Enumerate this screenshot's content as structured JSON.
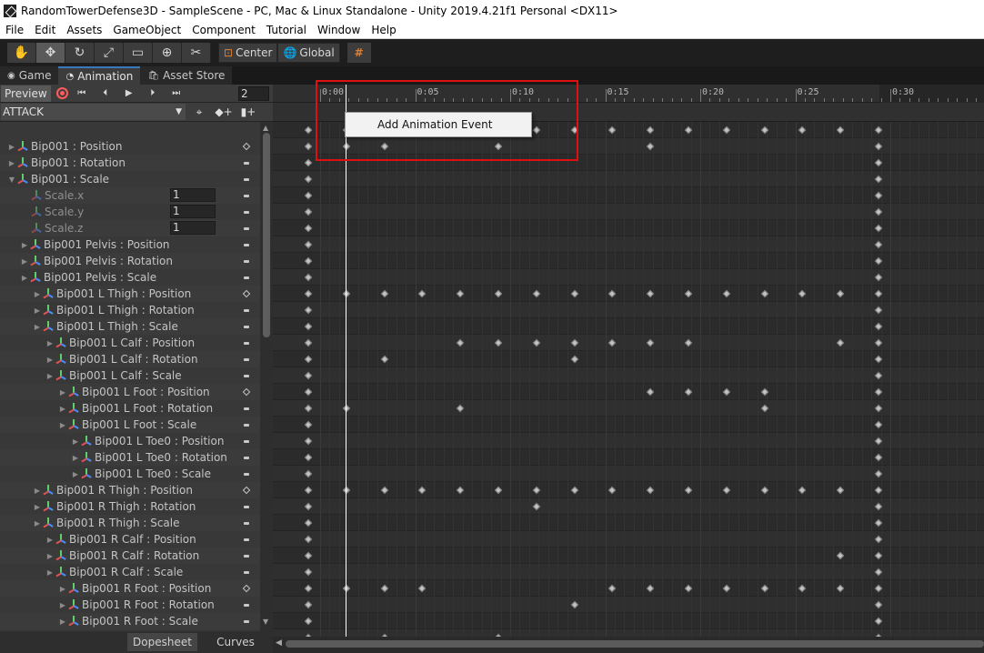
{
  "window": {
    "title": "RandomTowerDefense3D - SampleScene - PC, Mac & Linux Standalone - Unity 2019.4.21f1 Personal <DX11>"
  },
  "menu": [
    "File",
    "Edit",
    "Assets",
    "GameObject",
    "Component",
    "Tutorial",
    "Window",
    "Help"
  ],
  "toolbar": {
    "tools": [
      {
        "icon": "hand-icon",
        "glyph": "✋"
      },
      {
        "icon": "move-icon",
        "glyph": "✥"
      },
      {
        "icon": "rotate-icon",
        "glyph": "↻"
      },
      {
        "icon": "scale-icon",
        "glyph": "⤢"
      },
      {
        "icon": "rect-icon",
        "glyph": "▭"
      },
      {
        "icon": "transform-icon",
        "glyph": "⊕"
      },
      {
        "icon": "custom-tool-icon",
        "glyph": "✂"
      }
    ],
    "active_tool": 1,
    "pivot_label": "Center",
    "space_label": "Global",
    "grid_glyph": "#"
  },
  "tabs": [
    {
      "label": "Game",
      "icon": "gamepad-icon",
      "glyph": "◉"
    },
    {
      "label": "Animation",
      "icon": "animation-icon",
      "glyph": "◔"
    },
    {
      "label": "Asset Store",
      "icon": "store-icon",
      "glyph": "🛍"
    }
  ],
  "active_tab": 1,
  "animation": {
    "preview_label": "Preview",
    "frame_value": "2",
    "clip_name": "ATTACK",
    "timeline_labels": [
      "0:00",
      "0:05",
      "0:10",
      "0:15",
      "0:20",
      "0:25",
      "0:30",
      "0:3"
    ],
    "dopesheet_label": "Dopesheet",
    "curves_label": "Curves",
    "context_menu_item": "Add Animation Event"
  },
  "colors": {
    "highlight_box": "#e01010",
    "record": "#ff5c5c",
    "key": "#c2c2c2"
  },
  "properties": [
    {
      "label": "Bip001 : Position",
      "indent": 0,
      "expanded": false,
      "kind": "prop",
      "marker": "dot"
    },
    {
      "label": "Bip001 : Rotation",
      "indent": 0,
      "expanded": false,
      "kind": "prop",
      "marker": "dash"
    },
    {
      "label": "Bip001 : Scale",
      "indent": 0,
      "expanded": true,
      "kind": "prop",
      "marker": "dash"
    },
    {
      "label": "Scale.x",
      "indent": 1,
      "kind": "sub",
      "value": "1",
      "marker": "dash"
    },
    {
      "label": "Scale.y",
      "indent": 1,
      "kind": "sub",
      "value": "1",
      "marker": "dash"
    },
    {
      "label": "Scale.z",
      "indent": 1,
      "kind": "sub",
      "value": "1",
      "marker": "dash"
    },
    {
      "label": "Bip001 Pelvis : Position",
      "indent": 1,
      "expanded": false,
      "kind": "prop",
      "marker": "dash"
    },
    {
      "label": "Bip001 Pelvis : Rotation",
      "indent": 1,
      "expanded": false,
      "kind": "prop",
      "marker": "dash"
    },
    {
      "label": "Bip001 Pelvis : Scale",
      "indent": 1,
      "expanded": false,
      "kind": "prop",
      "marker": "dash"
    },
    {
      "label": "Bip001 L Thigh : Position",
      "indent": 2,
      "expanded": false,
      "kind": "prop",
      "marker": "dot"
    },
    {
      "label": "Bip001 L Thigh : Rotation",
      "indent": 2,
      "expanded": false,
      "kind": "prop",
      "marker": "dash"
    },
    {
      "label": "Bip001 L Thigh : Scale",
      "indent": 2,
      "expanded": false,
      "kind": "prop",
      "marker": "dash"
    },
    {
      "label": "Bip001 L Calf : Position",
      "indent": 3,
      "expanded": false,
      "kind": "prop",
      "marker": "dash"
    },
    {
      "label": "Bip001 L Calf : Rotation",
      "indent": 3,
      "expanded": false,
      "kind": "prop",
      "marker": "dash"
    },
    {
      "label": "Bip001 L Calf : Scale",
      "indent": 3,
      "expanded": false,
      "kind": "prop",
      "marker": "dash"
    },
    {
      "label": "Bip001 L Foot : Position",
      "indent": 4,
      "expanded": false,
      "kind": "prop",
      "marker": "dot"
    },
    {
      "label": "Bip001 L Foot : Rotation",
      "indent": 4,
      "expanded": false,
      "kind": "prop",
      "marker": "dash"
    },
    {
      "label": "Bip001 L Foot : Scale",
      "indent": 4,
      "expanded": false,
      "kind": "prop",
      "marker": "dash"
    },
    {
      "label": "Bip001 L Toe0 : Position",
      "indent": 5,
      "expanded": false,
      "kind": "prop",
      "marker": "dash"
    },
    {
      "label": "Bip001 L Toe0 : Rotation",
      "indent": 5,
      "expanded": false,
      "kind": "prop",
      "marker": "dash"
    },
    {
      "label": "Bip001 L Toe0 : Scale",
      "indent": 5,
      "expanded": false,
      "kind": "prop",
      "marker": "dash"
    },
    {
      "label": "Bip001 R Thigh : Position",
      "indent": 2,
      "expanded": false,
      "kind": "prop",
      "marker": "dot"
    },
    {
      "label": "Bip001 R Thigh : Rotation",
      "indent": 2,
      "expanded": false,
      "kind": "prop",
      "marker": "dash"
    },
    {
      "label": "Bip001 R Thigh : Scale",
      "indent": 2,
      "expanded": false,
      "kind": "prop",
      "marker": "dash"
    },
    {
      "label": "Bip001 R Calf : Position",
      "indent": 3,
      "expanded": false,
      "kind": "prop",
      "marker": "dash"
    },
    {
      "label": "Bip001 R Calf : Rotation",
      "indent": 3,
      "expanded": false,
      "kind": "prop",
      "marker": "dash"
    },
    {
      "label": "Bip001 R Calf : Scale",
      "indent": 3,
      "expanded": false,
      "kind": "prop",
      "marker": "dash"
    },
    {
      "label": "Bip001 R Foot : Position",
      "indent": 4,
      "expanded": false,
      "kind": "prop",
      "marker": "dot"
    },
    {
      "label": "Bip001 R Foot : Rotation",
      "indent": 4,
      "expanded": false,
      "kind": "prop",
      "marker": "dash"
    },
    {
      "label": "Bip001 R Foot : Scale",
      "indent": 4,
      "expanded": false,
      "kind": "prop",
      "marker": "dash"
    }
  ],
  "keyframes": {
    "summary": [
      0,
      2,
      4,
      6,
      8,
      10,
      12,
      14,
      16,
      18,
      20,
      22,
      24,
      26,
      28,
      30
    ],
    "rows": [
      [
        0,
        1,
        2,
        5,
        9,
        15
      ],
      [
        0,
        15
      ],
      [
        0,
        15
      ],
      [
        0,
        15
      ],
      [
        0,
        15
      ],
      [
        0,
        15
      ],
      [
        0,
        15
      ],
      [
        0,
        15
      ],
      [
        0,
        15
      ],
      [
        0,
        1,
        2,
        3,
        4,
        5,
        6,
        7,
        8,
        9,
        10,
        11,
        12,
        13,
        14,
        15
      ],
      [
        0,
        15
      ],
      [
        0,
        15
      ],
      [
        0,
        4,
        5,
        6,
        7,
        8,
        9,
        10,
        14,
        15
      ],
      [
        0,
        2,
        7,
        15
      ],
      [
        0,
        15
      ],
      [
        0,
        9,
        10,
        11,
        12,
        15
      ],
      [
        0,
        1,
        4,
        12,
        15
      ],
      [
        0,
        15
      ],
      [
        0,
        15
      ],
      [
        0,
        15
      ],
      [
        0,
        15
      ],
      [
        0,
        1,
        2,
        3,
        4,
        5,
        6,
        7,
        8,
        9,
        10,
        11,
        12,
        13,
        14,
        15
      ],
      [
        0,
        6,
        15
      ],
      [
        0,
        15
      ],
      [
        0,
        15
      ],
      [
        0,
        14,
        15
      ],
      [
        0,
        15
      ],
      [
        0,
        1,
        2,
        3,
        8,
        9,
        10,
        11,
        12,
        13,
        14,
        15
      ],
      [
        0,
        7,
        15
      ],
      [
        0,
        15
      ]
    ],
    "extra_bottom": [
      0,
      2,
      5,
      15
    ]
  }
}
